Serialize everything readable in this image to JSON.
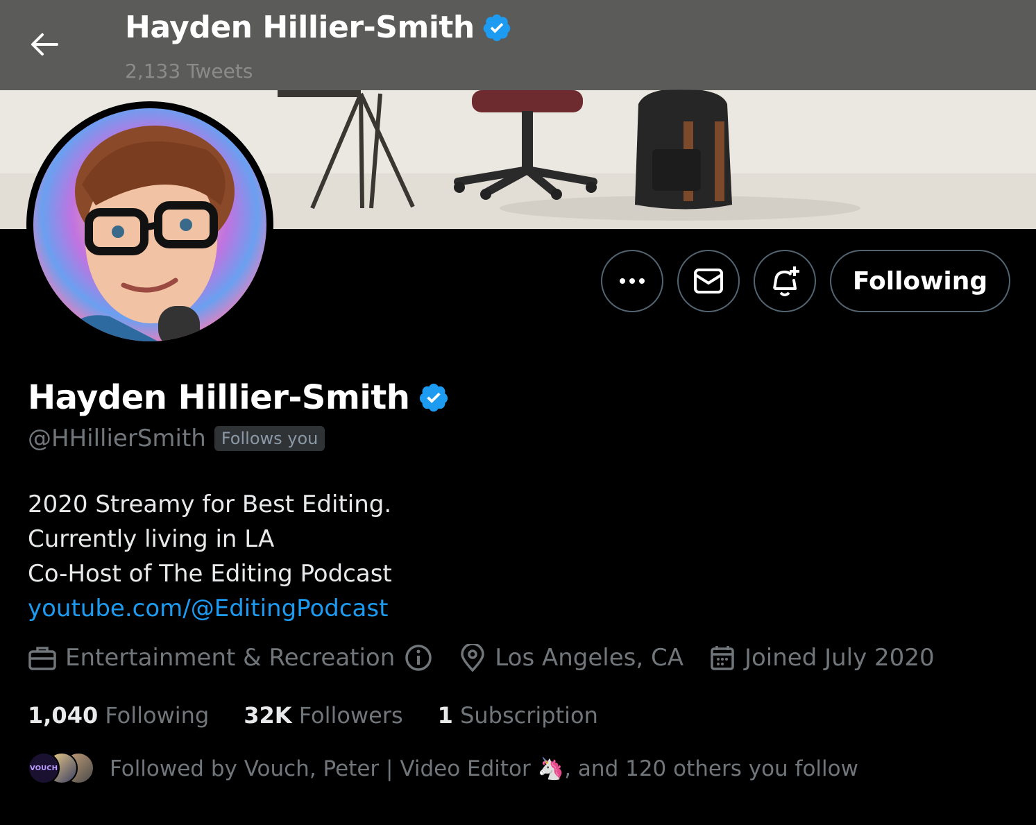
{
  "header": {
    "back_icon": "arrow-left-icon",
    "name": "Hayden Hillier-Smith",
    "tweet_count": "2,133 Tweets"
  },
  "profile": {
    "name": "Hayden Hillier-Smith",
    "verified": true,
    "verified_color": "#1d9bf0",
    "handle": "@HHillierSmith",
    "follows_you": "Follows you",
    "bio": {
      "line1": "2020 Streamy for Best Editing.",
      "line2": "Currently living in LA",
      "line3": "Co-Host of The Editing Podcast",
      "link": "youtube.com/@EditingPodcast"
    },
    "category": "Entertainment & Recreation",
    "location": "Los Angeles, CA",
    "joined": "Joined July 2020"
  },
  "actions": {
    "more_icon": "more-icon",
    "message_icon": "mail-icon",
    "notify_icon": "bell-plus-icon",
    "following_label": "Following"
  },
  "stats": {
    "following_count": "1,040",
    "following_label": "Following",
    "followers_count": "32K",
    "followers_label": "Followers",
    "subscription_count": "1",
    "subscription_label": "Subscription"
  },
  "followed_by": {
    "text": "Followed by Vouch, Peter | Video Editor 🦄, and 120 others you follow",
    "first_avatar_text": "VOUCH"
  },
  "colors": {
    "background": "#000000",
    "link": "#1d9bf0",
    "muted": "#71767b",
    "border": "#536471"
  }
}
